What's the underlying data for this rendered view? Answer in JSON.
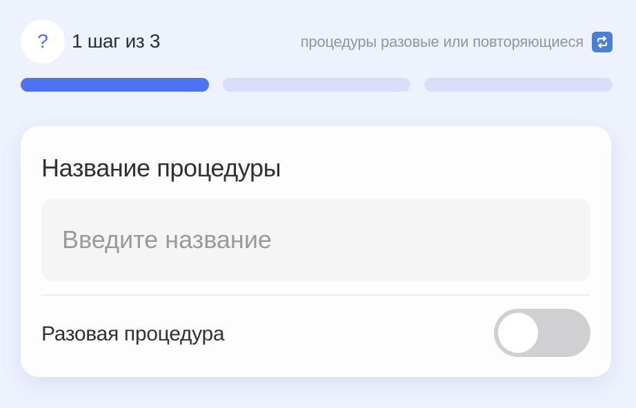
{
  "header": {
    "help_symbol": "?",
    "step_label": "1 шаг из 3",
    "hint": "процедуры разовые или повторяющиеся",
    "hint_icon": "repeat-icon"
  },
  "progress": {
    "current_step": 1,
    "total_steps": 3,
    "active_color": "#4f73f0",
    "inactive_color": "#d9dff9"
  },
  "form": {
    "title": "Название процедуры",
    "name_input": {
      "value": "",
      "placeholder": "Введите название"
    },
    "one_time_toggle": {
      "label": "Разовая процедура",
      "checked": false
    }
  }
}
